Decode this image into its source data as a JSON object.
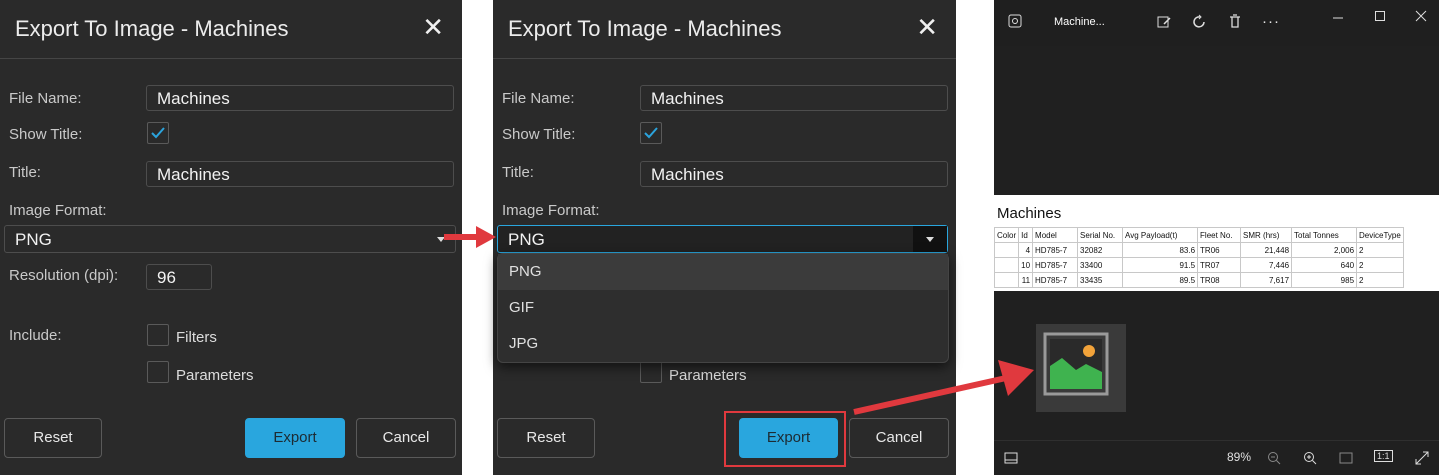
{
  "dialog": {
    "title": "Export To Image - Machines",
    "close": "✕",
    "file_name_label": "File Name:",
    "file_name_value": "Machines",
    "show_title_label": "Show Title:",
    "title_label": "Title:",
    "title_value": "Machines",
    "image_format_label": "Image Format:",
    "image_format_value": "PNG",
    "resolution_label": "Resolution (dpi):",
    "resolution_value": "96",
    "include_label": "Include:",
    "filters_label": "Filters",
    "parameters_label": "Parameters",
    "reset_label": "Reset",
    "export_label": "Export",
    "cancel_label": "Cancel",
    "format_options": [
      "PNG",
      "GIF",
      "JPG"
    ]
  },
  "viewer": {
    "title": "Machine...",
    "zoom": "89%",
    "image_title": "Machines",
    "columns": [
      "Color",
      "Id",
      "Model",
      "Serial No.",
      "Avg Payload(t)",
      "Fleet No.",
      "SMR (hrs)",
      "Total Tonnes",
      "DeviceType"
    ],
    "rows": [
      [
        "",
        "4",
        "HD785-7",
        "32082",
        "83.6",
        "TR06",
        "21,448",
        "2,006",
        "2"
      ],
      [
        "",
        "10",
        "HD785-7",
        "33400",
        "91.5",
        "TR07",
        "7,446",
        "640",
        "2"
      ],
      [
        "",
        "11",
        "HD785-7",
        "33435",
        "89.5",
        "TR08",
        "7,617",
        "985",
        "2"
      ]
    ],
    "actual_size": "1:1"
  },
  "colors": {
    "accent": "#29a6de",
    "annotation": "#e0393e",
    "dialog_bg": "#2a2a2a"
  }
}
